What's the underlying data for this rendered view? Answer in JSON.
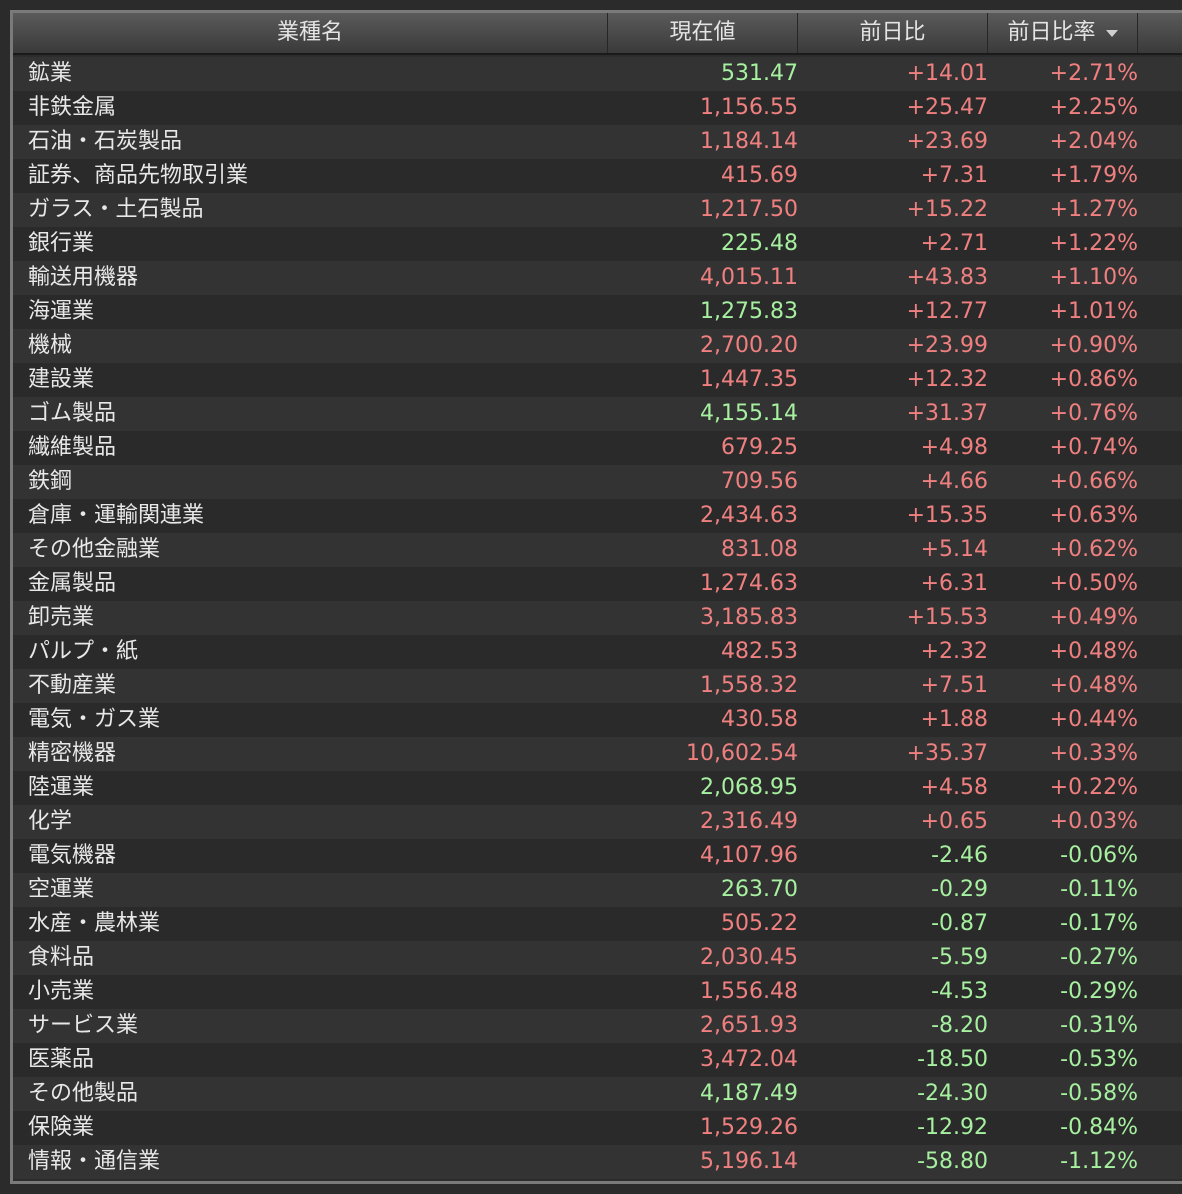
{
  "header": {
    "name_label": "業種名",
    "price_label": "現在値",
    "change_label": "前日比",
    "pct_label": "前日比率"
  },
  "colors": {
    "up": "#f08080",
    "down": "#a6f0a0"
  },
  "rows": [
    {
      "name": "鉱業",
      "price": "531.47",
      "price_dir": "down",
      "change": "+14.01",
      "pct": "+2.71%",
      "dir": "up"
    },
    {
      "name": "非鉄金属",
      "price": "1,156.55",
      "price_dir": "up",
      "change": "+25.47",
      "pct": "+2.25%",
      "dir": "up"
    },
    {
      "name": "石油・石炭製品",
      "price": "1,184.14",
      "price_dir": "up",
      "change": "+23.69",
      "pct": "+2.04%",
      "dir": "up"
    },
    {
      "name": "証券、商品先物取引業",
      "price": "415.69",
      "price_dir": "up",
      "change": "+7.31",
      "pct": "+1.79%",
      "dir": "up"
    },
    {
      "name": "ガラス・土石製品",
      "price": "1,217.50",
      "price_dir": "up",
      "change": "+15.22",
      "pct": "+1.27%",
      "dir": "up"
    },
    {
      "name": "銀行業",
      "price": "225.48",
      "price_dir": "down",
      "change": "+2.71",
      "pct": "+1.22%",
      "dir": "up"
    },
    {
      "name": "輸送用機器",
      "price": "4,015.11",
      "price_dir": "up",
      "change": "+43.83",
      "pct": "+1.10%",
      "dir": "up"
    },
    {
      "name": "海運業",
      "price": "1,275.83",
      "price_dir": "down",
      "change": "+12.77",
      "pct": "+1.01%",
      "dir": "up"
    },
    {
      "name": "機械",
      "price": "2,700.20",
      "price_dir": "up",
      "change": "+23.99",
      "pct": "+0.90%",
      "dir": "up"
    },
    {
      "name": "建設業",
      "price": "1,447.35",
      "price_dir": "up",
      "change": "+12.32",
      "pct": "+0.86%",
      "dir": "up"
    },
    {
      "name": "ゴム製品",
      "price": "4,155.14",
      "price_dir": "down",
      "change": "+31.37",
      "pct": "+0.76%",
      "dir": "up"
    },
    {
      "name": "繊維製品",
      "price": "679.25",
      "price_dir": "up",
      "change": "+4.98",
      "pct": "+0.74%",
      "dir": "up"
    },
    {
      "name": "鉄鋼",
      "price": "709.56",
      "price_dir": "up",
      "change": "+4.66",
      "pct": "+0.66%",
      "dir": "up"
    },
    {
      "name": "倉庫・運輸関連業",
      "price": "2,434.63",
      "price_dir": "up",
      "change": "+15.35",
      "pct": "+0.63%",
      "dir": "up"
    },
    {
      "name": "その他金融業",
      "price": "831.08",
      "price_dir": "up",
      "change": "+5.14",
      "pct": "+0.62%",
      "dir": "up"
    },
    {
      "name": "金属製品",
      "price": "1,274.63",
      "price_dir": "up",
      "change": "+6.31",
      "pct": "+0.50%",
      "dir": "up"
    },
    {
      "name": "卸売業",
      "price": "3,185.83",
      "price_dir": "up",
      "change": "+15.53",
      "pct": "+0.49%",
      "dir": "up"
    },
    {
      "name": "パルプ・紙",
      "price": "482.53",
      "price_dir": "up",
      "change": "+2.32",
      "pct": "+0.48%",
      "dir": "up"
    },
    {
      "name": "不動産業",
      "price": "1,558.32",
      "price_dir": "up",
      "change": "+7.51",
      "pct": "+0.48%",
      "dir": "up"
    },
    {
      "name": "電気・ガス業",
      "price": "430.58",
      "price_dir": "up",
      "change": "+1.88",
      "pct": "+0.44%",
      "dir": "up"
    },
    {
      "name": "精密機器",
      "price": "10,602.54",
      "price_dir": "up",
      "change": "+35.37",
      "pct": "+0.33%",
      "dir": "up"
    },
    {
      "name": "陸運業",
      "price": "2,068.95",
      "price_dir": "down",
      "change": "+4.58",
      "pct": "+0.22%",
      "dir": "up"
    },
    {
      "name": "化学",
      "price": "2,316.49",
      "price_dir": "up",
      "change": "+0.65",
      "pct": "+0.03%",
      "dir": "up"
    },
    {
      "name": "電気機器",
      "price": "4,107.96",
      "price_dir": "up",
      "change": "-2.46",
      "pct": "-0.06%",
      "dir": "down"
    },
    {
      "name": "空運業",
      "price": "263.70",
      "price_dir": "down",
      "change": "-0.29",
      "pct": "-0.11%",
      "dir": "down"
    },
    {
      "name": "水産・農林業",
      "price": "505.22",
      "price_dir": "up",
      "change": "-0.87",
      "pct": "-0.17%",
      "dir": "down"
    },
    {
      "name": "食料品",
      "price": "2,030.45",
      "price_dir": "up",
      "change": "-5.59",
      "pct": "-0.27%",
      "dir": "down"
    },
    {
      "name": "小売業",
      "price": "1,556.48",
      "price_dir": "up",
      "change": "-4.53",
      "pct": "-0.29%",
      "dir": "down"
    },
    {
      "name": "サービス業",
      "price": "2,651.93",
      "price_dir": "up",
      "change": "-8.20",
      "pct": "-0.31%",
      "dir": "down"
    },
    {
      "name": "医薬品",
      "price": "3,472.04",
      "price_dir": "up",
      "change": "-18.50",
      "pct": "-0.53%",
      "dir": "down"
    },
    {
      "name": "その他製品",
      "price": "4,187.49",
      "price_dir": "down",
      "change": "-24.30",
      "pct": "-0.58%",
      "dir": "down"
    },
    {
      "name": "保険業",
      "price": "1,529.26",
      "price_dir": "up",
      "change": "-12.92",
      "pct": "-0.84%",
      "dir": "down"
    },
    {
      "name": "情報・通信業",
      "price": "5,196.14",
      "price_dir": "up",
      "change": "-58.80",
      "pct": "-1.12%",
      "dir": "down"
    }
  ]
}
